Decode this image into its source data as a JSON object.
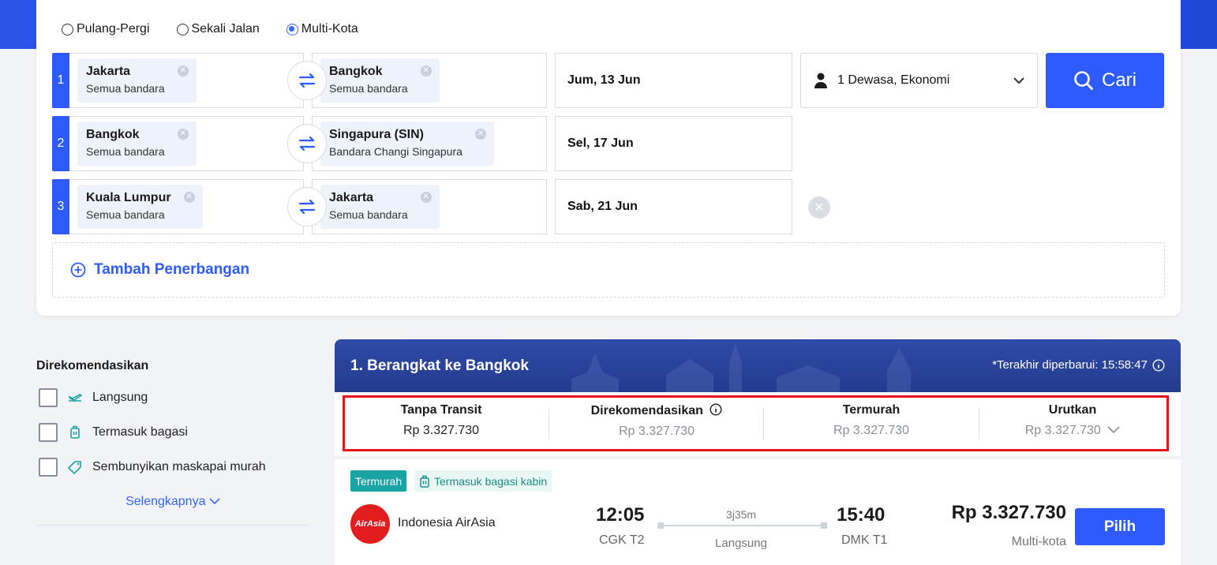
{
  "trip_types": [
    {
      "label": "Pulang-Pergi",
      "selected": false
    },
    {
      "label": "Sekali Jalan",
      "selected": false
    },
    {
      "label": "Multi-Kota",
      "selected": true
    }
  ],
  "legs": [
    {
      "num": "1",
      "from": {
        "city": "Jakarta",
        "airport": "Semua bandara"
      },
      "to": {
        "city": "Bangkok",
        "airport": "Semua bandara"
      },
      "date": "Jum, 13 Jun"
    },
    {
      "num": "2",
      "from": {
        "city": "Bangkok",
        "airport": "Semua bandara"
      },
      "to": {
        "city": "Singapura (SIN)",
        "airport": "Bandara Changi Singapura"
      },
      "date": "Sel, 17 Jun"
    },
    {
      "num": "3",
      "from": {
        "city": "Kuala Lumpur",
        "airport": "Semua bandara"
      },
      "to": {
        "city": "Jakarta",
        "airport": "Semua bandara"
      },
      "date": "Sab, 21 Jun"
    }
  ],
  "passengers": "1 Dewasa, Ekonomi",
  "search_label": "Cari",
  "add_flight_label": "Tambah Penerbangan",
  "filters": {
    "title": "Direkomendasikan",
    "items": [
      "Langsung",
      "Termasuk bagasi",
      "Sembunyikan maskapai murah"
    ],
    "more_label": "Selengkapnya"
  },
  "results": {
    "title": "1. Berangkat ke Bangkok",
    "updated": "*Terakhir diperbarui: 15:58:47",
    "sort_options": [
      {
        "label": "Tanpa Transit",
        "price": "Rp 3.327.730",
        "active": true
      },
      {
        "label": "Direkomendasikan",
        "price": "Rp 3.327.730",
        "active": false
      },
      {
        "label": "Termurah",
        "price": "Rp 3.327.730",
        "active": false
      },
      {
        "label": "Urutkan",
        "price": "Rp 3.327.730",
        "active": false
      }
    ],
    "flight": {
      "tags": [
        "Termurah",
        "Termasuk bagasi kabin"
      ],
      "airline": "Indonesia AirAsia",
      "logo_text": "AirAsia",
      "depart_time": "12:05",
      "depart_airport": "CGK T2",
      "duration": "3j35m",
      "stops": "Langsung",
      "arrive_time": "15:40",
      "arrive_airport": "DMK T1",
      "price": "Rp 3.327.730",
      "price_note": "Multi-kota",
      "select_label": "Pilih"
    }
  },
  "colors": {
    "accent": "#2e5bff",
    "highlight_border": "#e4141c",
    "tag_teal": "#1aa3a3"
  }
}
